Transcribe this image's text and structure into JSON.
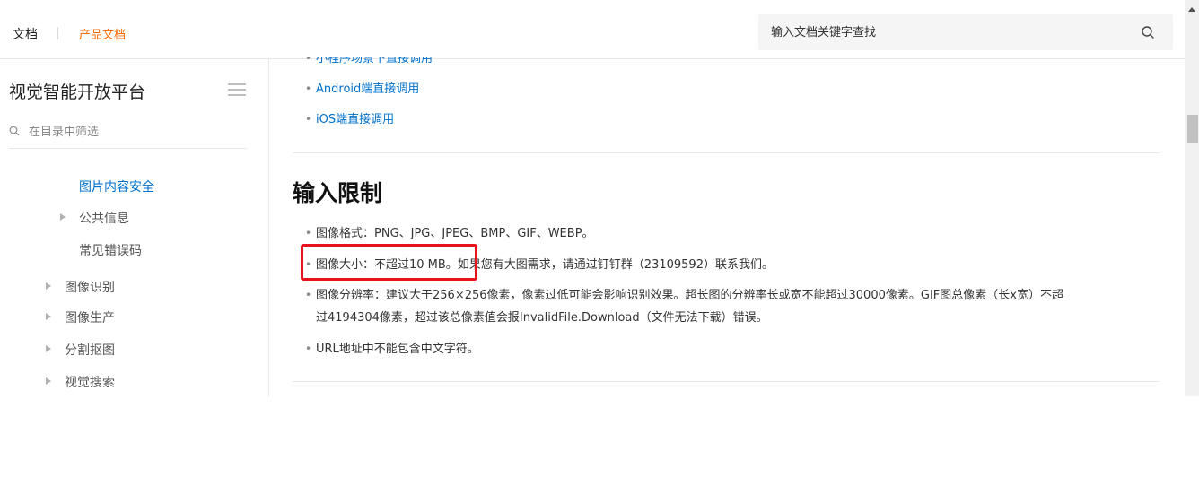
{
  "topbar": {
    "brand": "文档",
    "product_docs": "产品文档",
    "search_placeholder": "输入文档关键字查找"
  },
  "sidebar": {
    "title": "视觉智能开放平台",
    "filter_placeholder": "在目录中筛选",
    "items": [
      {
        "label": "图片内容安全",
        "active": true,
        "expandable": false
      },
      {
        "label": "公共信息",
        "active": false,
        "expandable": true
      },
      {
        "label": "常见错误码",
        "active": false,
        "expandable": false
      },
      {
        "label": "图像识别",
        "active": false,
        "expandable": true
      },
      {
        "label": "图像生产",
        "active": false,
        "expandable": true
      },
      {
        "label": "分割抠图",
        "active": false,
        "expandable": true
      },
      {
        "label": "视觉搜索",
        "active": false,
        "expandable": true
      }
    ]
  },
  "content": {
    "links": [
      "小程序场景下直接调用",
      "Android端直接调用",
      "iOS端直接调用"
    ],
    "section_title": "输入限制",
    "bullets": [
      "图像格式：PNG、JPG、JPEG、BMP、GIF、WEBP。",
      "图像大小：不超过10 MB。如果您有大图需求，请通过钉钉群（23109592）联系我们。",
      "图像分辨率：建议大于256×256像素，像素过低可能会影响识别效果。超长图的分辨率长或宽不能超过30000像素。GIF图总像素（长x宽）不超",
      "过4194304像素，超过该总像素值会报InvalidFile.Download（文件无法下载）错误。",
      "URL地址中不能包含中文字符。"
    ]
  },
  "colors": {
    "accent": "#0070cc",
    "brand_orange": "#ff6a00",
    "highlight_red": "#e8121c"
  }
}
